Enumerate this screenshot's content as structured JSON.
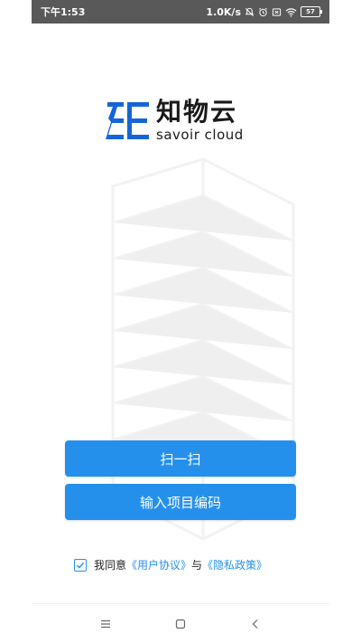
{
  "status_bar": {
    "time": "下午1:53",
    "net_speed": "1.0K/s",
    "battery": "57"
  },
  "logo": {
    "name_cn": "知物云",
    "name_en": "savoir cloud"
  },
  "buttons": {
    "scan_label": "扫一扫",
    "enter_code_label": "输入项目编码"
  },
  "agreement": {
    "prefix": "我同意",
    "user_agreement": "《用户协议》",
    "connector": "与",
    "privacy_policy": "《隐私政策》",
    "checked": true
  },
  "nav_bar": {
    "icons": [
      "menu-icon",
      "home-icon",
      "back-icon"
    ]
  },
  "colors": {
    "accent": "#2490ec",
    "status_bar_bg": "#595959",
    "logo_blue": "#1565d8"
  }
}
